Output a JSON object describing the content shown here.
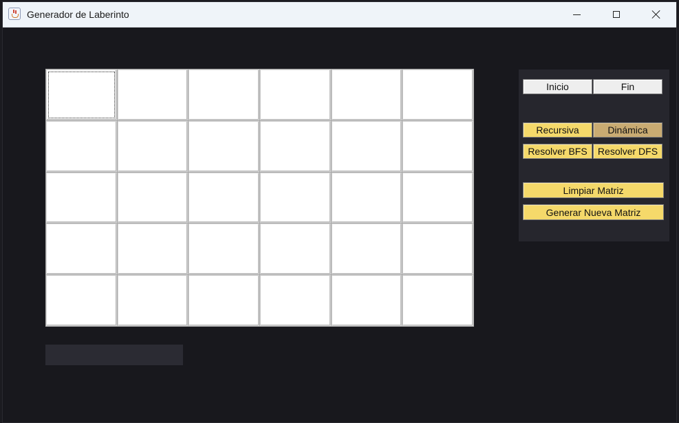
{
  "window": {
    "title": "Generador de Laberinto",
    "controls": {
      "minimize_icon": "minimize-icon",
      "maximize_icon": "maximize-icon",
      "close_icon": "close-icon"
    }
  },
  "maze": {
    "rows": 5,
    "columns": 6,
    "focused_cell": [
      0,
      0
    ],
    "cell_color": "#ffffff"
  },
  "panel": {
    "start_label": "Inicio",
    "end_label": "Fin",
    "recursive_label": "Recursiva",
    "dynamic_label": "Dinámica",
    "bfs_label": "Resolver BFS",
    "dfs_label": "Resolver DFS",
    "clear_label": "Limpiar Matriz",
    "new_matrix_label": "Generar Nueva Matriz"
  },
  "colors": {
    "background": "#18181d",
    "panel": "#26262d",
    "button_yellow": "#f5d96a",
    "button_selected": "#c9ab72",
    "button_gray": "#eeeeee"
  }
}
